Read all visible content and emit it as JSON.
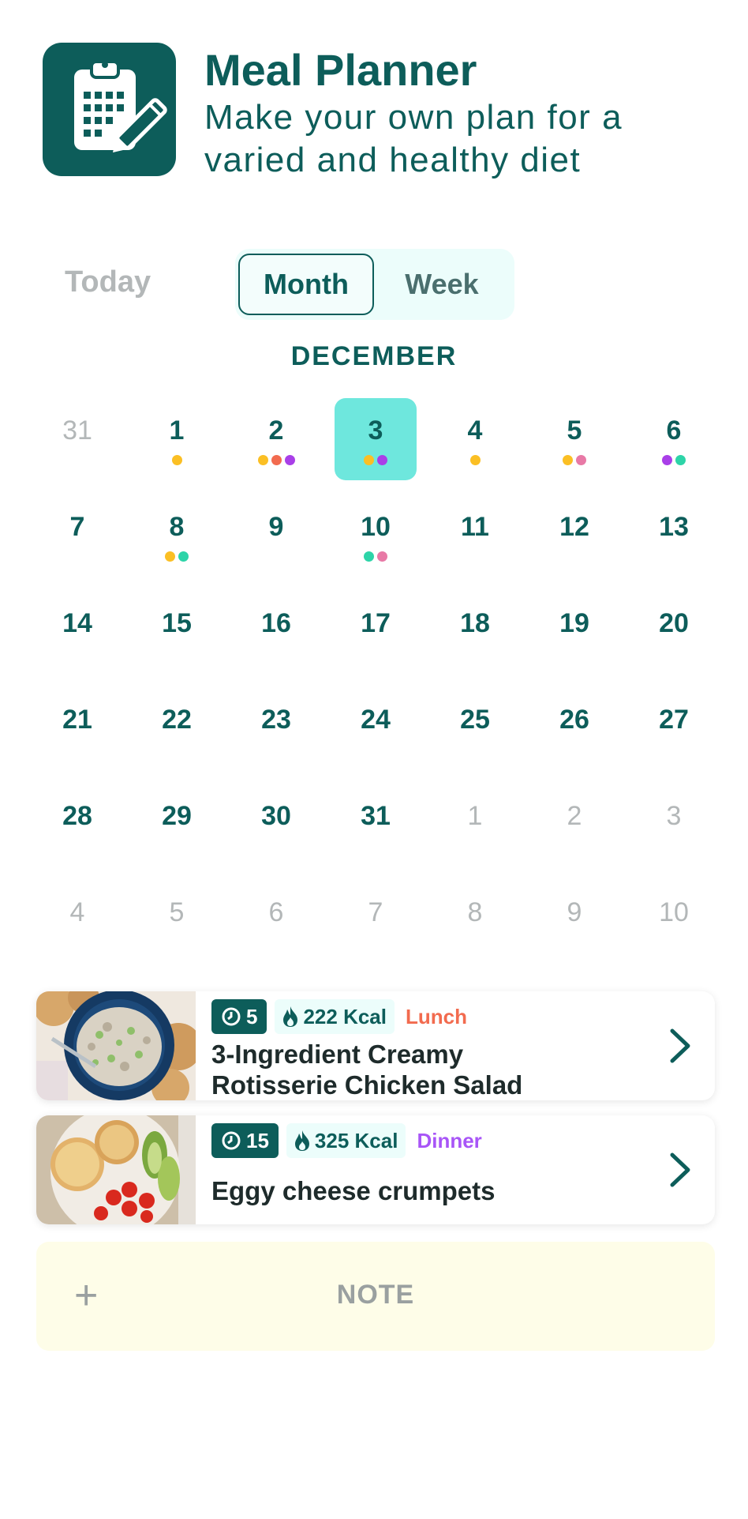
{
  "app": {
    "title": "Meal Planner",
    "subtitle": "Make your own plan for a varied and healthy diet",
    "logo_icon": "clipboard-pencil-icon"
  },
  "controls": {
    "today_label": "Today",
    "view_toggle": {
      "options": [
        "Month",
        "Week"
      ],
      "selected": "Month"
    }
  },
  "calendar": {
    "month_label": "DECEMBER",
    "selected_day": 3,
    "dot_colors": {
      "orange": "#fbbf24",
      "red": "#f26b4f",
      "purple": "#a93fe8",
      "green": "#2dd4a8",
      "pink": "#e879a6"
    },
    "weeks": [
      [
        {
          "d": "31",
          "muted": true,
          "dots": []
        },
        {
          "d": "1",
          "dots": [
            "orange"
          ]
        },
        {
          "d": "2",
          "dots": [
            "orange",
            "red",
            "purple"
          ]
        },
        {
          "d": "3",
          "selected": true,
          "dots": [
            "orange",
            "purple"
          ]
        },
        {
          "d": "4",
          "dots": [
            "orange"
          ]
        },
        {
          "d": "5",
          "dots": [
            "orange",
            "pink"
          ]
        },
        {
          "d": "6",
          "dots": [
            "purple",
            "green"
          ]
        }
      ],
      [
        {
          "d": "7",
          "dots": []
        },
        {
          "d": "8",
          "dots": [
            "orange",
            "green"
          ]
        },
        {
          "d": "9",
          "dots": []
        },
        {
          "d": "10",
          "dots": [
            "green",
            "pink"
          ]
        },
        {
          "d": "11",
          "dots": []
        },
        {
          "d": "12",
          "dots": []
        },
        {
          "d": "13",
          "dots": []
        }
      ],
      [
        {
          "d": "14",
          "dots": []
        },
        {
          "d": "15",
          "dots": []
        },
        {
          "d": "16",
          "dots": []
        },
        {
          "d": "17",
          "dots": []
        },
        {
          "d": "18",
          "dots": []
        },
        {
          "d": "19",
          "dots": []
        },
        {
          "d": "20",
          "dots": []
        }
      ],
      [
        {
          "d": "21",
          "dots": []
        },
        {
          "d": "22",
          "dots": []
        },
        {
          "d": "23",
          "dots": []
        },
        {
          "d": "24",
          "dots": []
        },
        {
          "d": "25",
          "dots": []
        },
        {
          "d": "26",
          "dots": []
        },
        {
          "d": "27",
          "dots": []
        }
      ],
      [
        {
          "d": "28",
          "dots": []
        },
        {
          "d": "29",
          "dots": []
        },
        {
          "d": "30",
          "dots": []
        },
        {
          "d": "31",
          "dots": []
        },
        {
          "d": "1",
          "muted": true,
          "dots": []
        },
        {
          "d": "2",
          "muted": true,
          "dots": []
        },
        {
          "d": "3",
          "muted": true,
          "dots": []
        }
      ],
      [
        {
          "d": "4",
          "muted": true,
          "dots": []
        },
        {
          "d": "5",
          "muted": true,
          "dots": []
        },
        {
          "d": "6",
          "muted": true,
          "dots": []
        },
        {
          "d": "7",
          "muted": true,
          "dots": []
        },
        {
          "d": "8",
          "muted": true,
          "dots": []
        },
        {
          "d": "9",
          "muted": true,
          "dots": []
        },
        {
          "d": "10",
          "muted": true,
          "dots": []
        }
      ]
    ]
  },
  "meals": [
    {
      "time": "5",
      "kcal": "222 Kcal",
      "type": "Lunch",
      "type_color": "#f26b4f",
      "title_line1": "3-Ingredient Creamy",
      "title_line2": "Rotisserie Chicken Salad",
      "thumb_icon": "chicken-salad-photo"
    },
    {
      "time": "15",
      "kcal": "325 Kcal",
      "type": "Dinner",
      "type_color": "#a855f7",
      "title_line1": "Eggy cheese crumpets",
      "title_line2": "",
      "thumb_icon": "crumpets-photo"
    }
  ],
  "note": {
    "plus_icon": "plus-icon",
    "label": "NOTE"
  }
}
